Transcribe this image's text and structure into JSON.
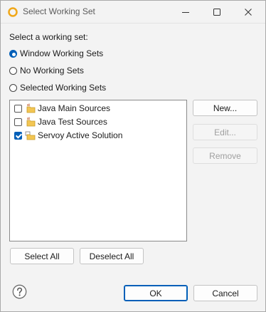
{
  "window": {
    "title": "Select Working Set",
    "icons": {
      "app": "eclipse-ring-icon",
      "minimize": "minimize-icon",
      "maximize": "maximize-icon",
      "close": "close-icon"
    }
  },
  "prompt": "Select a working set:",
  "options": [
    {
      "label": "Window Working Sets",
      "selected": true
    },
    {
      "label": "No Working Sets",
      "selected": false
    },
    {
      "label": "Selected Working Sets",
      "selected": false
    }
  ],
  "working_sets": [
    {
      "label": "Java Main Sources",
      "checked": false,
      "icon": "java-working-set-icon"
    },
    {
      "label": "Java Test Sources",
      "checked": false,
      "icon": "java-working-set-icon"
    },
    {
      "label": "Servoy Active Solution",
      "checked": true,
      "icon": "resource-working-set-icon"
    }
  ],
  "side_buttons": {
    "new": "New...",
    "edit": "Edit...",
    "remove": "Remove"
  },
  "bulk_buttons": {
    "select_all": "Select All",
    "deselect_all": "Deselect All"
  },
  "footer": {
    "ok": "OK",
    "cancel": "Cancel",
    "help_icon": "help-icon"
  },
  "colors": {
    "accent": "#005fb8",
    "folder": "#f3c653"
  }
}
